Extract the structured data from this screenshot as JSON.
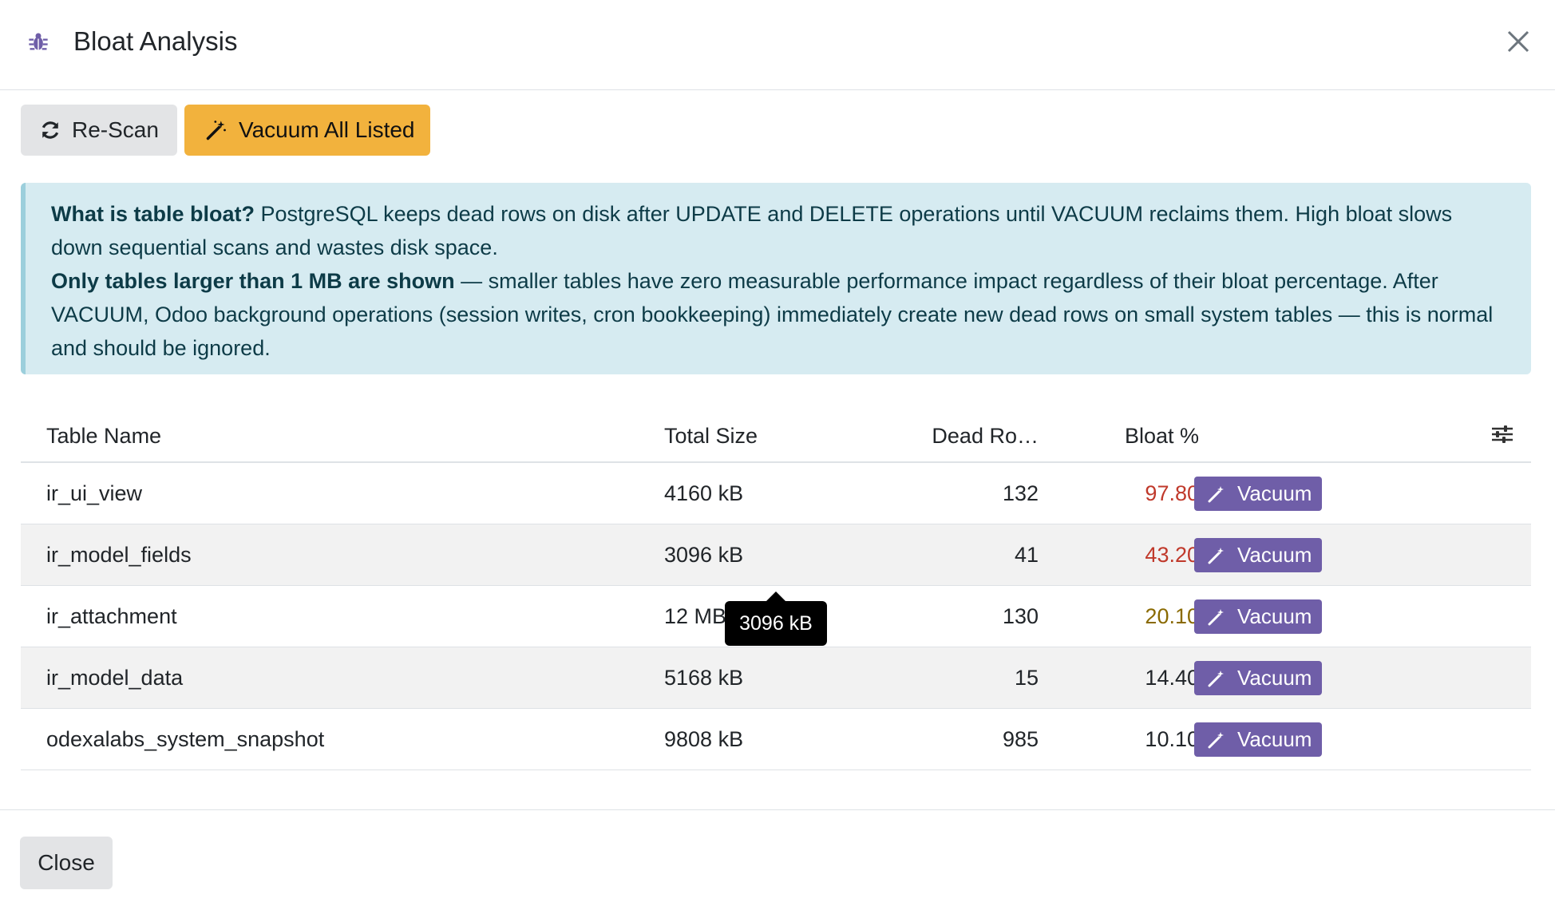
{
  "header": {
    "title": "Bloat Analysis",
    "icon": "bug-icon"
  },
  "toolbar": {
    "rescan_label": "Re-Scan",
    "vacuum_all_label": "Vacuum All Listed"
  },
  "info": {
    "title_bold": "What is table bloat?",
    "title_text": " PostgreSQL keeps dead rows on disk after UPDATE and DELETE operations until VACUUM reclaims them. High bloat slows down sequential scans and wastes disk space.",
    "note_bold": "Only tables larger than 1 MB are shown",
    "note_text": " — smaller tables have zero measurable performance impact regardless of their bloat percentage. After VACUUM, Odoo background operations (session writes, cron bookkeeping) immediately create new dead rows on small system tables — this is normal and should be ignored."
  },
  "table": {
    "columns": {
      "name": "Table Name",
      "size": "Total Size",
      "dead": "Dead Ro…",
      "bloat": "Bloat %"
    },
    "action_label": "Vacuum",
    "rows": [
      {
        "name": "ir_ui_view",
        "size": "4160 kB",
        "dead": "132",
        "bloat": "97.80"
      },
      {
        "name": "ir_model_fields",
        "size": "3096 kB",
        "dead": "41",
        "bloat": "43.20"
      },
      {
        "name": "ir_attachment",
        "size": "12 MB",
        "dead": "130",
        "bloat": "20.10"
      },
      {
        "name": "ir_model_data",
        "size": "5168 kB",
        "dead": "15",
        "bloat": "14.40"
      },
      {
        "name": "odexalabs_system_snapshot",
        "size": "9808 kB",
        "dead": "985",
        "bloat": "10.10"
      }
    ]
  },
  "tooltip": {
    "text": "3096 kB"
  },
  "footer": {
    "close_label": "Close"
  },
  "colors": {
    "primary": "#6f5ea8",
    "warning": "#f2b23d",
    "danger": "#c0392b",
    "caution": "#8a6a00",
    "info_bg": "#d6ebf1"
  }
}
